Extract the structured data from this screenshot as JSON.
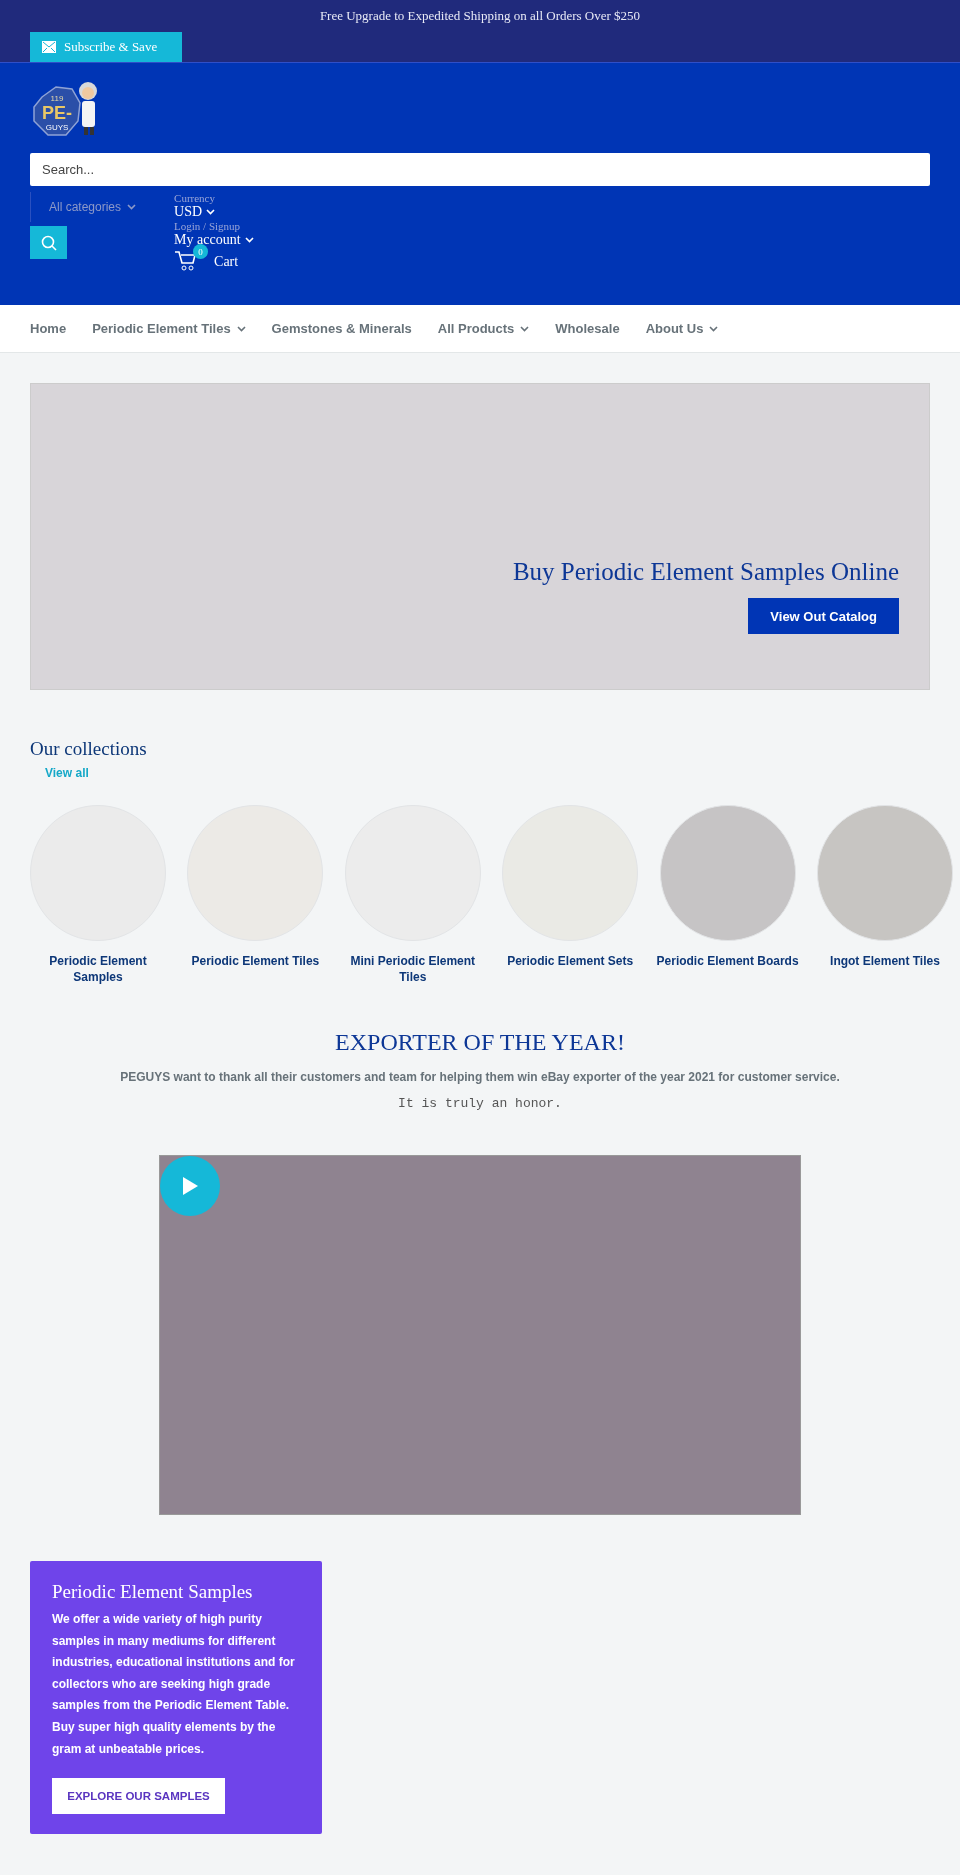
{
  "announcement": "Free Upgrade to Expedited Shipping on all Orders Over $250",
  "subscribe": {
    "label": "Subscribe & Save"
  },
  "logo": {
    "number": "119",
    "line1": "PE-",
    "line2": "GUYS"
  },
  "search": {
    "placeholder": "Search...",
    "category": "All categories"
  },
  "account": {
    "currency_label": "Currency",
    "currency": "USD",
    "login": "Login / Signup",
    "account": "My account",
    "cart_count": "0",
    "cart": "Cart"
  },
  "nav": [
    {
      "label": "Home",
      "dropdown": false
    },
    {
      "label": "Periodic Element Tiles",
      "dropdown": true
    },
    {
      "label": "Gemstones & Minerals",
      "dropdown": false
    },
    {
      "label": "All Products",
      "dropdown": true
    },
    {
      "label": "Wholesale",
      "dropdown": false
    },
    {
      "label": "About Us",
      "dropdown": true
    }
  ],
  "hero": {
    "title": "Buy Periodic Element Samples Online",
    "button": "View Out Catalog"
  },
  "collections": {
    "title": "Our collections",
    "view_all": "View all",
    "items": [
      {
        "name": "Periodic Element Samples",
        "color": "#ebebeb"
      },
      {
        "name": "Periodic Element Tiles",
        "color": "#eceae6"
      },
      {
        "name": "Mini Periodic Element Tiles",
        "color": "#ececec"
      },
      {
        "name": "Periodic Element Sets",
        "color": "#eaeae5"
      },
      {
        "name": "Periodic Element Boards",
        "color": "#c6c4c5"
      },
      {
        "name": "Ingot Element Tiles",
        "color": "#c7c5c2"
      }
    ]
  },
  "exporter": {
    "title": "EXPORTER OF THE YEAR!",
    "text": "PEGUYS want to thank all their customers and team for helping them win eBay exporter of the year 2021 for customer service.",
    "note": "It is truly an honor."
  },
  "promo": {
    "title": "Periodic Element Samples",
    "text": "We offer a wide variety of high purity samples in many mediums for different industries, educational institutions and for collectors who are seeking high grade samples from the Periodic Element Table. Buy super high quality elements by the gram at unbeatable prices.",
    "button": "EXPLORE OUR SAMPLES"
  }
}
